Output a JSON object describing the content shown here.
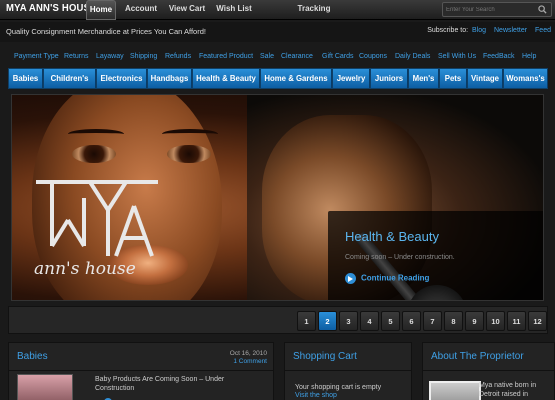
{
  "site": {
    "logo": "MYA ANN'S HOUSE",
    "tagline": "Quality Consignment Merchandice at Prices You Can Afford!"
  },
  "topnav": [
    {
      "label": "Home",
      "active": true
    },
    {
      "label": "Account",
      "active": false
    },
    {
      "label": "View Cart",
      "active": false
    },
    {
      "label": "Wish List",
      "active": false
    },
    {
      "label": "Tracking",
      "active": false
    }
  ],
  "search": {
    "placeholder": "Enter Your Search"
  },
  "subscribe": {
    "label": "Subscribe to:",
    "links": [
      "Blog",
      "Newsletter",
      "Feed"
    ]
  },
  "pages": [
    "Payment Type",
    "Returns",
    "Layaway",
    "Shipping",
    "Refunds",
    "Featured Product",
    "Sale",
    "Clearance",
    "Gift Cards",
    "Coupons",
    "Daily Deals",
    "Sell With Us",
    "FeedBack",
    "Help"
  ],
  "categories": [
    "Babies",
    "Children's",
    "Electronics",
    "Handbags",
    "Health & Beauty",
    "Home & Gardens",
    "Jewelry",
    "Juniors",
    "Men's",
    "Pets",
    "Vintage",
    "Womans's"
  ],
  "hero": {
    "logo_text": "ann's house",
    "title": "Health & Beauty",
    "subtitle": "Coming soon – Under construction.",
    "link": "Continue Reading"
  },
  "pager": {
    "pages": [
      "1",
      "2",
      "3",
      "4",
      "5",
      "6",
      "7",
      "8",
      "9",
      "10",
      "11",
      "12"
    ],
    "active": "2"
  },
  "columns": {
    "babies": {
      "title": "Babies",
      "date": "Oct 16, 2010",
      "comments": "1 Comment",
      "text": "Baby Products  Are Coming Soon – Under Construction"
    },
    "cart": {
      "title": "Shopping Cart",
      "text": "Your shopping cart is empty",
      "link": "Visit the shop"
    },
    "proprietor": {
      "title": "About The Proprietor",
      "text": "Mya native born in Detroit raised in"
    }
  },
  "colors": {
    "accent": "#3fa0e6",
    "category_bar": "#0d5ea3",
    "background": "#1a1a1a"
  }
}
